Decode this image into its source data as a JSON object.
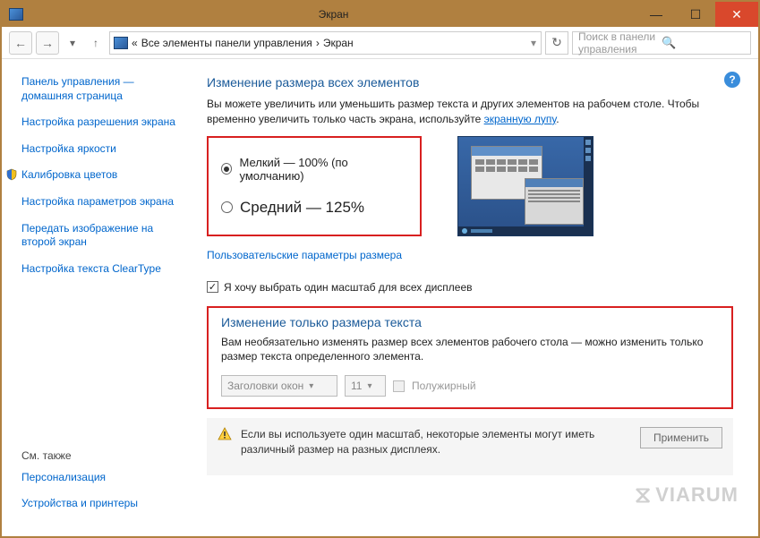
{
  "window": {
    "title": "Экран"
  },
  "nav": {
    "breadcrumb_prefix": "«",
    "breadcrumb_parent": "Все элементы панели управления",
    "breadcrumb_current": "Экран",
    "search_placeholder": "Поиск в панели управления"
  },
  "sidebar": {
    "items": [
      "Панель управления — домашняя страница",
      "Настройка разрешения экрана",
      "Настройка яркости",
      "Калибровка цветов",
      "Настройка параметров экрана",
      "Передать изображение на второй экран",
      "Настройка текста ClearType"
    ],
    "see_also_header": "См. также",
    "see_also": [
      "Персонализация",
      "Устройства и принтеры"
    ]
  },
  "main": {
    "heading1": "Изменение размера всех элементов",
    "desc1": "Вы можете увеличить или уменьшить размер текста и других элементов на рабочем столе. Чтобы временно увеличить только часть экрана, используйте ",
    "desc1_link": "экранную лупу",
    "radio_small": "Мелкий — 100% (по умолчанию)",
    "radio_medium": "Средний — 125%",
    "custom_link": "Пользовательские параметры размера",
    "checkbox_one_scale": "Я хочу выбрать один масштаб для всех дисплеев",
    "heading2": "Изменение только размера текста",
    "desc2": "Вам необязательно изменять размер всех элементов рабочего стола — можно изменить только размер текста определенного элемента.",
    "combo_element": "Заголовки окон",
    "combo_size": "11",
    "bold_label": "Полужирный",
    "footer_warning": "Если вы используете один масштаб, некоторые элементы могут иметь различный размер на разных дисплеях.",
    "apply_button": "Применить"
  },
  "watermark": "VIARUM"
}
